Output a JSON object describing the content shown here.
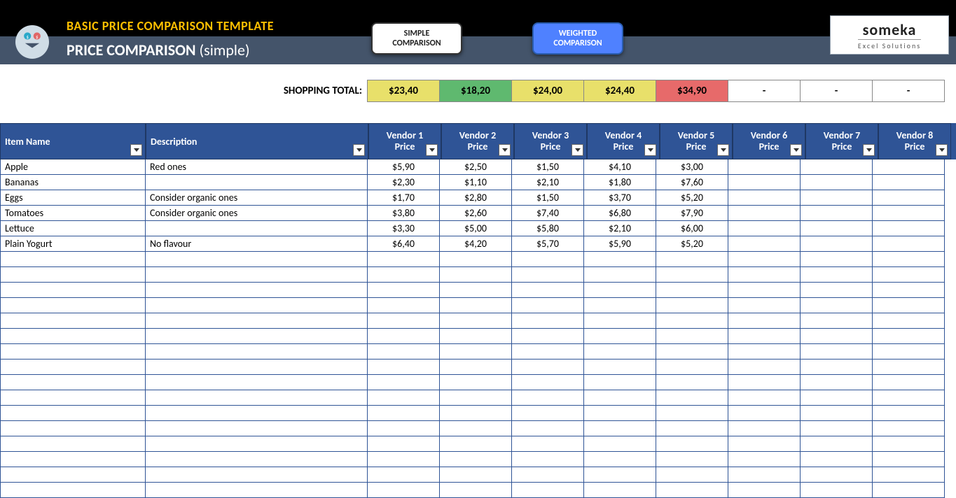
{
  "header": {
    "title": "BASIC PRICE COMPARISON TEMPLATE",
    "subtitle_strong": "PRICE COMPARISON",
    "subtitle_thin": "(simple)",
    "btn_simple_l1": "SIMPLE",
    "btn_simple_l2": "COMPARISON",
    "btn_weighted_l1": "WEIGHTED",
    "btn_weighted_l2": "COMPARISON",
    "logo_main": "someka",
    "logo_sub": "Excel Solutions"
  },
  "totals": {
    "label": "SHOPPING TOTAL:",
    "cells": [
      {
        "val": "$23,40",
        "cls": "c-yellow"
      },
      {
        "val": "$18,20",
        "cls": "c-green"
      },
      {
        "val": "$24,00",
        "cls": "c-yellow"
      },
      {
        "val": "$24,40",
        "cls": "c-yellow"
      },
      {
        "val": "$34,90",
        "cls": "c-red"
      },
      {
        "val": "-",
        "cls": "c-blank"
      },
      {
        "val": "-",
        "cls": "c-blank"
      },
      {
        "val": "-",
        "cls": "c-blank"
      }
    ]
  },
  "columns": {
    "item": "Item Name",
    "desc": "Description",
    "vendors": [
      "Vendor 1",
      "Vendor 2",
      "Vendor 3",
      "Vendor 4",
      "Vendor 5",
      "Vendor 6",
      "Vendor 7",
      "Vendor 8"
    ],
    "price_word": "Price"
  },
  "rows": [
    {
      "item": "Apple",
      "desc": "Red ones",
      "p": [
        "$5,90",
        "$2,50",
        "$1,50",
        "$4,10",
        "$3,00",
        "",
        "",
        ""
      ]
    },
    {
      "item": "Bananas",
      "desc": "",
      "p": [
        "$2,30",
        "$1,10",
        "$2,10",
        "$1,80",
        "$7,60",
        "",
        "",
        ""
      ]
    },
    {
      "item": "Eggs",
      "desc": "Consider organic ones",
      "p": [
        "$1,70",
        "$2,80",
        "$1,50",
        "$3,70",
        "$5,20",
        "",
        "",
        ""
      ]
    },
    {
      "item": "Tomatoes",
      "desc": "Consider organic ones",
      "p": [
        "$3,80",
        "$2,60",
        "$7,40",
        "$6,80",
        "$7,90",
        "",
        "",
        ""
      ]
    },
    {
      "item": "Lettuce",
      "desc": "",
      "p": [
        "$3,30",
        "$5,00",
        "$5,80",
        "$2,10",
        "$6,00",
        "",
        "",
        ""
      ]
    },
    {
      "item": "Plain Yogurt",
      "desc": "No flavour",
      "p": [
        "$6,40",
        "$4,20",
        "$5,70",
        "$5,90",
        "$5,20",
        "",
        "",
        ""
      ]
    }
  ],
  "empty_rows": 16
}
